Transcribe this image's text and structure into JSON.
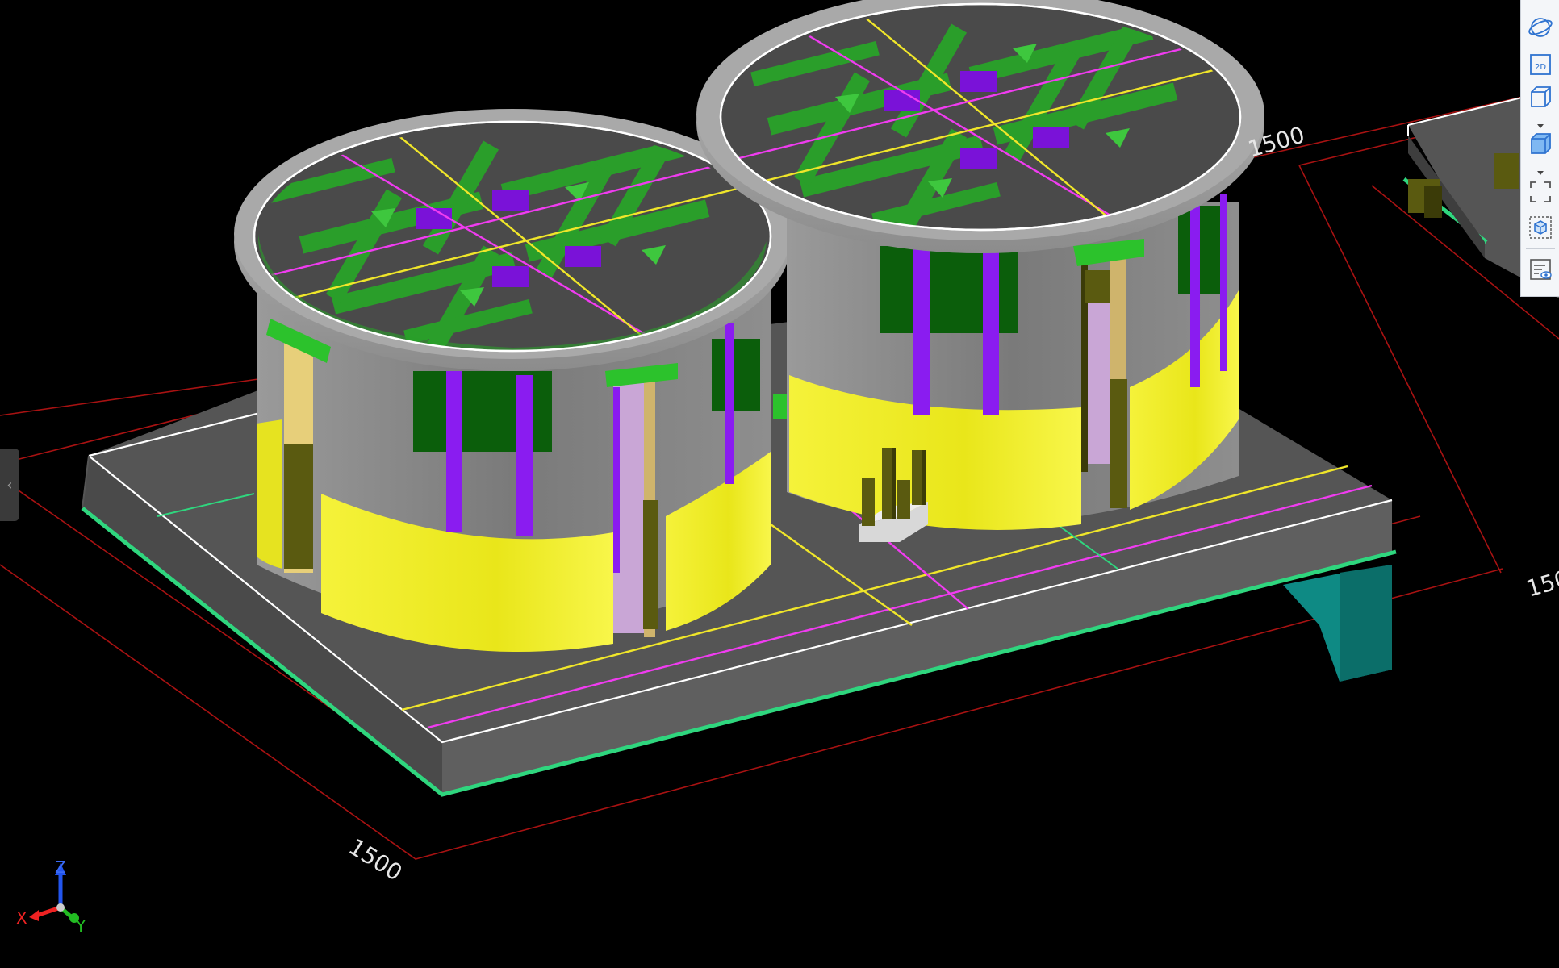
{
  "viewport": {
    "background": "#000000",
    "dimensions": [
      "1500",
      "1500",
      "1500"
    ]
  },
  "axes": {
    "x": "X",
    "y": "Y",
    "z": "Z"
  },
  "side_panel": {
    "collapse_glyph": "‹"
  },
  "toolbar": {
    "buttons": [
      {
        "name": "orbit-view-icon",
        "label": ""
      },
      {
        "name": "2d-view-icon",
        "label": "2D"
      },
      {
        "name": "3d-box-icon",
        "label": ""
      },
      {
        "name": "shaded-box-icon",
        "label": ""
      },
      {
        "name": "fit-view-icon",
        "label": ""
      },
      {
        "name": "isolate-object-icon",
        "label": ""
      },
      {
        "name": "properties-view-icon",
        "label": ""
      }
    ]
  },
  "colors": {
    "slab_top": "#555555",
    "slab_edge": "#2fd67e",
    "wall_gray": "#8a8a8a",
    "wall_yellow": "#f2ef1a",
    "column_purple": "#8a1cf0",
    "rebar_green": "#2a9e2a",
    "grid_yellow": "#f0e62a",
    "grid_magenta": "#f03cf0",
    "dim_red": "#b01010",
    "teal_column": "#0e8a84"
  }
}
